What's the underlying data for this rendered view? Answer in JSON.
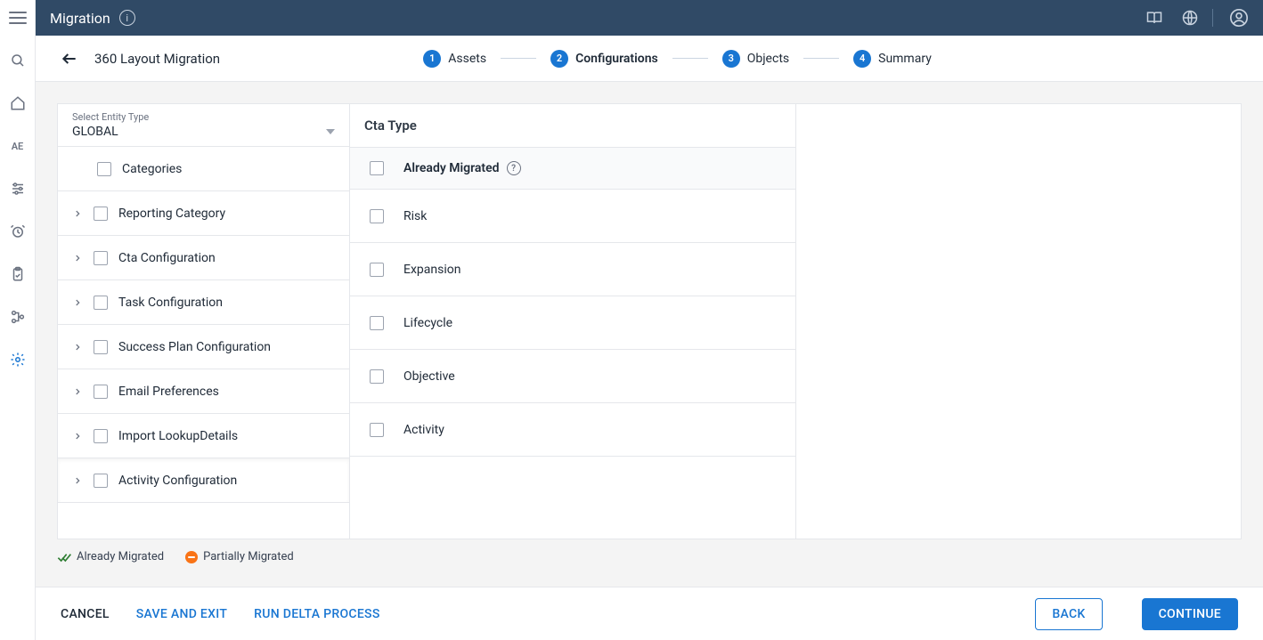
{
  "appbar": {
    "title": "Migration"
  },
  "subheader": {
    "title": "360 Layout Migration"
  },
  "stepper": [
    {
      "num": "1",
      "label": "Assets"
    },
    {
      "num": "2",
      "label": "Configurations"
    },
    {
      "num": "3",
      "label": "Objects"
    },
    {
      "num": "4",
      "label": "Summary"
    }
  ],
  "entity": {
    "label": "Select Entity Type",
    "value": "GLOBAL"
  },
  "tree": [
    {
      "label": "Categories",
      "expandable": false
    },
    {
      "label": "Reporting Category",
      "expandable": true
    },
    {
      "label": "Cta Configuration",
      "expandable": true
    },
    {
      "label": "Task Configuration",
      "expandable": true
    },
    {
      "label": "Success Plan Configuration",
      "expandable": true
    },
    {
      "label": "Email Preferences",
      "expandable": true
    },
    {
      "label": "Import LookupDetails",
      "expandable": true
    },
    {
      "label": "Activity Configuration",
      "expandable": true
    }
  ],
  "detail": {
    "title": "Cta Type",
    "header": "Already Migrated",
    "rows": [
      "Risk",
      "Expansion",
      "Lifecycle",
      "Objective",
      "Activity"
    ]
  },
  "legend": {
    "migrated": "Already Migrated",
    "partial": "Partially Migrated"
  },
  "footer": {
    "cancel": "CANCEL",
    "save": "SAVE AND EXIT",
    "delta": "RUN DELTA PROCESS",
    "back": "BACK",
    "continue": "CONTINUE"
  },
  "rail": {
    "ae": "AE"
  }
}
